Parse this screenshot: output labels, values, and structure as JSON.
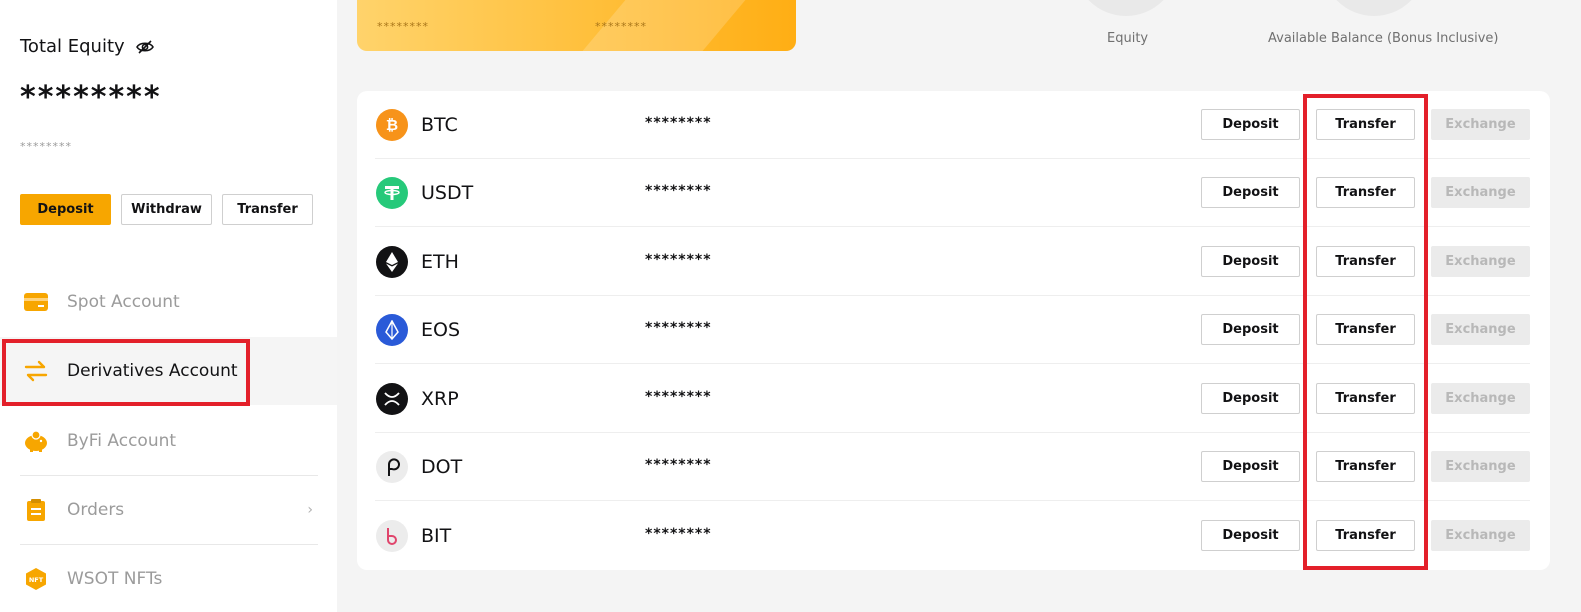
{
  "sidebar": {
    "equity_title": "Total Equity",
    "equity_value": "********",
    "equity_sub": "********",
    "buttons": {
      "deposit": "Deposit",
      "withdraw": "Withdraw",
      "transfer": "Transfer"
    },
    "nav": [
      {
        "label": "Spot Account",
        "icon": "card-icon"
      },
      {
        "label": "Derivatives Account",
        "icon": "swap-arrows-icon",
        "active": true
      },
      {
        "label": "ByFi Account",
        "icon": "piggy-bank-icon"
      },
      {
        "label": "Orders",
        "icon": "clipboard-icon",
        "chevron": "›"
      },
      {
        "label": "WSOT NFTs",
        "icon": "nft-badge-icon"
      }
    ]
  },
  "banner": {
    "mask_left": "********",
    "mask_right": "********"
  },
  "summary": {
    "equity_label": "Equity",
    "available_label": "Available Balance (Bonus Inclusive)"
  },
  "assets": {
    "deposit_label": "Deposit",
    "transfer_label": "Transfer",
    "exchange_label": "Exchange",
    "rows": [
      {
        "coin": "BTC",
        "balance": "********",
        "icon": "btc-icon",
        "color": "#f7931a"
      },
      {
        "coin": "USDT",
        "balance": "********",
        "icon": "usdt-icon",
        "color": "#26c97a"
      },
      {
        "coin": "ETH",
        "balance": "********",
        "icon": "eth-icon",
        "color": "#121214"
      },
      {
        "coin": "EOS",
        "balance": "********",
        "icon": "eos-icon",
        "color": "#2a5ad8"
      },
      {
        "coin": "XRP",
        "balance": "********",
        "icon": "xrp-icon",
        "color": "#121214"
      },
      {
        "coin": "DOT",
        "balance": "********",
        "icon": "dot-icon",
        "color": "#ececec"
      },
      {
        "coin": "BIT",
        "balance": "********",
        "icon": "bit-icon",
        "color": "#ececec"
      }
    ]
  },
  "colors": {
    "accent": "#f7a600",
    "highlight": "#e3202a"
  }
}
